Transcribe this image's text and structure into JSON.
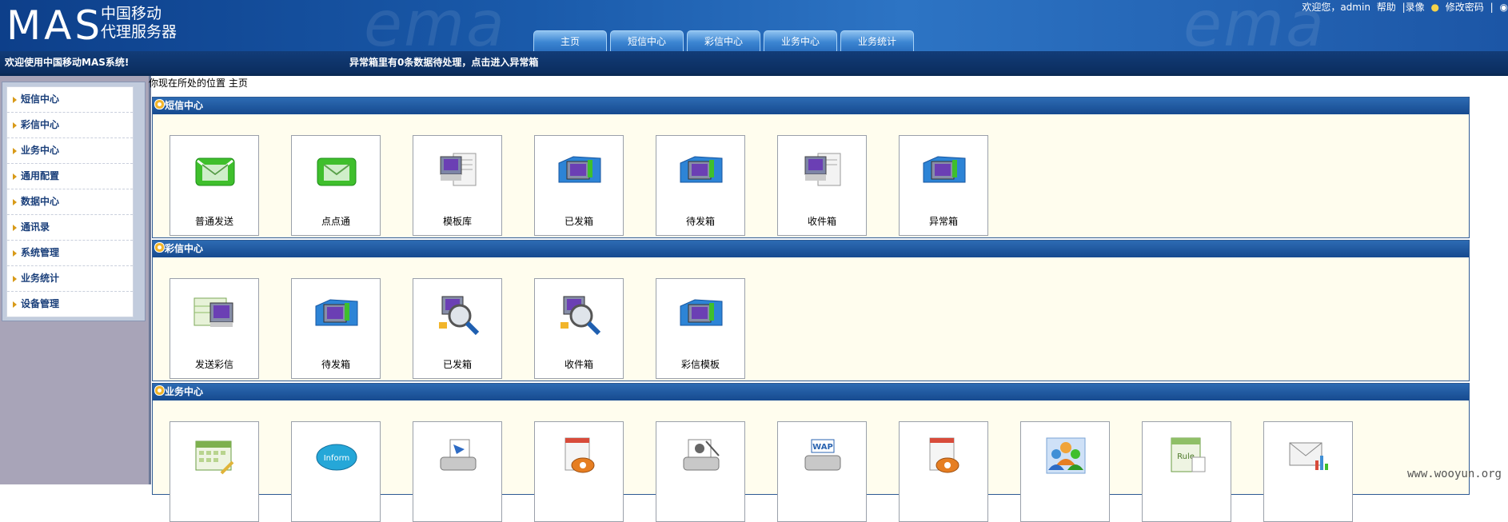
{
  "header": {
    "logo_main": "MAS",
    "logo_line1": "中国移动",
    "logo_line2": "代理服务器",
    "watermark": "ema",
    "greeting": "欢迎您，admin",
    "help": "帮助",
    "record": "|录像",
    "change_password": "修改密码",
    "separator": "|",
    "nav_tabs": [
      "主页",
      "短信中心",
      "彩信中心",
      "业务中心",
      "业务统计"
    ]
  },
  "welcome": {
    "message": "欢迎使用中国移动MAS系统!",
    "alert": "异常箱里有0条数据待处理，点击进入异常箱"
  },
  "sidebar": {
    "items": [
      "短信中心",
      "彩信中心",
      "业务中心",
      "通用配置",
      "数据中心",
      "通讯录",
      "系统管理",
      "业务统计",
      "设备管理"
    ]
  },
  "breadcrumb": "你现在所处的位置 主页",
  "sections": [
    {
      "title": "短信中心",
      "tiles": [
        {
          "label": "普通发送",
          "icon": "green-envelope-icon"
        },
        {
          "label": "点点通",
          "icon": "green-envelope-icon"
        },
        {
          "label": "模板库",
          "icon": "template-docs-icon"
        },
        {
          "label": "已发箱",
          "icon": "blue-folder-icon"
        },
        {
          "label": "待发箱",
          "icon": "blue-folder-icon"
        },
        {
          "label": "收件箱",
          "icon": "inbox-docs-icon"
        },
        {
          "label": "异常箱",
          "icon": "blue-folder-icon"
        }
      ]
    },
    {
      "title": "彩信中心",
      "tiles": [
        {
          "label": "发送彩信",
          "icon": "send-mms-icon"
        },
        {
          "label": "待发箱",
          "icon": "blue-folder-icon"
        },
        {
          "label": "已发箱",
          "icon": "magnifier-icon"
        },
        {
          "label": "收件箱",
          "icon": "magnifier-icon"
        },
        {
          "label": "彩信模板",
          "icon": "blue-folder-icon"
        }
      ]
    },
    {
      "title": "业务中心",
      "tiles": [
        {
          "label": "",
          "icon": "calendar-icon"
        },
        {
          "label": "",
          "icon": "inform-bubble-icon",
          "text": "Inform"
        },
        {
          "label": "",
          "icon": "inbox-tray-icon"
        },
        {
          "label": "",
          "icon": "phone-doc-icon"
        },
        {
          "label": "",
          "icon": "camera-tray-icon"
        },
        {
          "label": "",
          "icon": "wap-tray-icon",
          "text": "WAP"
        },
        {
          "label": "",
          "icon": "phone-doc-icon"
        },
        {
          "label": "",
          "icon": "users-icon"
        },
        {
          "label": "",
          "icon": "rule-doc-icon",
          "text": "Rule"
        },
        {
          "label": "",
          "icon": "mail-chart-icon"
        }
      ]
    }
  ],
  "credit": "www.wooyun.org",
  "colors": {
    "header_blue": "#1a5aaa",
    "welcome_bar": "#0b2d5e",
    "section_bg": "#fffdee",
    "section_header": "#164a8f",
    "menu_text": "#1a3f7a",
    "menu_arrow": "#d89a18"
  }
}
